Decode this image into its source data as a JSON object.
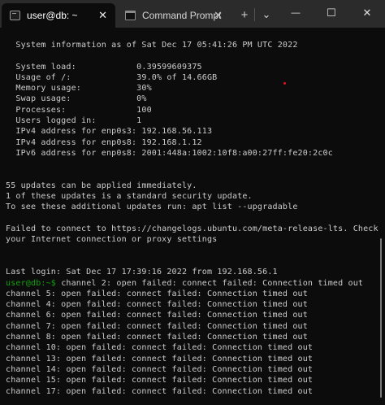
{
  "titlebar": {
    "tabs": [
      {
        "label": "user@db: ~",
        "active": true,
        "icon": "terminal-icon"
      },
      {
        "label": "Command Prompt",
        "active": false,
        "icon": "cmd-icon"
      }
    ],
    "close_glyph": "✕",
    "new_tab_glyph": "+",
    "dropdown_glyph": "⌄",
    "minimize_glyph": "—",
    "maximize_glyph": "☐",
    "window_close_glyph": "✕"
  },
  "terminal": {
    "prompt_label": "user@db:~$",
    "lines": [
      "  System information as of Sat Dec 17 05:41:26 PM UTC 2022",
      "",
      "  System load:            0.39599609375",
      "  Usage of /:             39.0% of 14.66GB",
      "  Memory usage:           30%",
      "  Swap usage:             0%",
      "  Processes:              100",
      "  Users logged in:        1",
      "  IPv4 address for enp0s3: 192.168.56.113",
      "  IPv4 address for enp0s8: 192.168.1.12",
      "  IPv6 address for enp0s8: 2001:448a:1002:10f8:a00:27ff:fe20:2c0c",
      "",
      "",
      "55 updates can be applied immediately.",
      "1 of these updates is a standard security update.",
      "To see these additional updates run: apt list --upgradable",
      "",
      "Failed to connect to https://changelogs.ubuntu.com/meta-release-lts. Check",
      "your Internet connection or proxy settings",
      "",
      "",
      "Last login: Sat Dec 17 17:39:16 2022 from 192.168.56.1",
      " channel 2: open failed: connect failed: Connection timed out",
      "channel 5: open failed: connect failed: Connection timed out",
      "channel 4: open failed: connect failed: Connection timed out",
      "channel 6: open failed: connect failed: Connection timed out",
      "channel 7: open failed: connect failed: Connection timed out",
      "channel 8: open failed: connect failed: Connection timed out",
      "channel 10: open failed: connect failed: Connection timed out",
      "channel 13: open failed: connect failed: Connection timed out",
      "channel 14: open failed: connect failed: Connection timed out",
      "channel 15: open failed: connect failed: Connection timed out",
      "channel 17: open failed: connect failed: Connection timed out"
    ],
    "prompt_line_index": 22,
    "colors": {
      "text": "#cccccc",
      "prompt": "#13a10e",
      "background": "#0c0c0c"
    }
  }
}
